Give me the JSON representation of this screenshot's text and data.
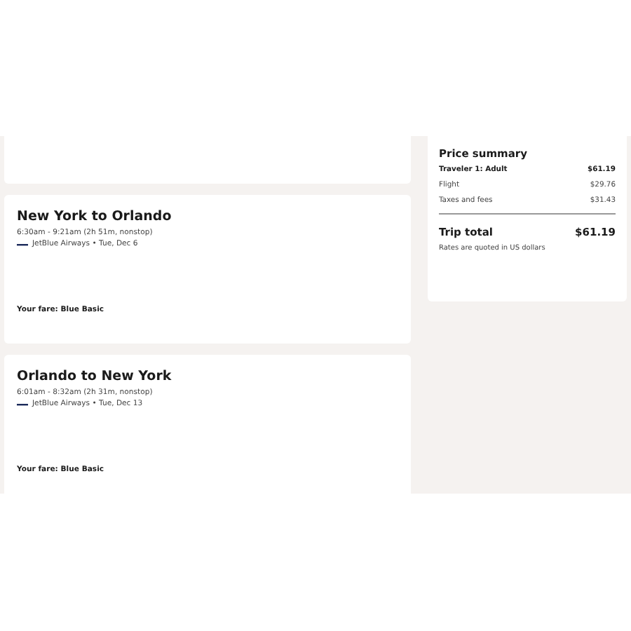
{
  "flights": [
    {
      "title": "New York to Orlando",
      "times": "6:30am - 9:21am (2h 51m, nonstop)",
      "airline": "JetBlue Airways • Tue, Dec 6",
      "fare": "Your fare: Blue Basic"
    },
    {
      "title": "Orlando to New York",
      "times": "6:01am - 8:32am (2h 31m, nonstop)",
      "airline": "JetBlue Airways • Tue, Dec 13",
      "fare": "Your fare: Blue Basic"
    }
  ],
  "price_summary": {
    "title": "Price summary",
    "lines": [
      {
        "kind": "header",
        "label": "Traveler 1: Adult",
        "amount": "$61.19"
      },
      {
        "kind": "item",
        "label": "Flight",
        "amount": "$29.76"
      },
      {
        "kind": "item",
        "label": "Taxes and fees",
        "amount": "$31.43"
      }
    ],
    "total_label": "Trip total",
    "total": "$61.19",
    "note": "Rates are quoted in US dollars"
  }
}
